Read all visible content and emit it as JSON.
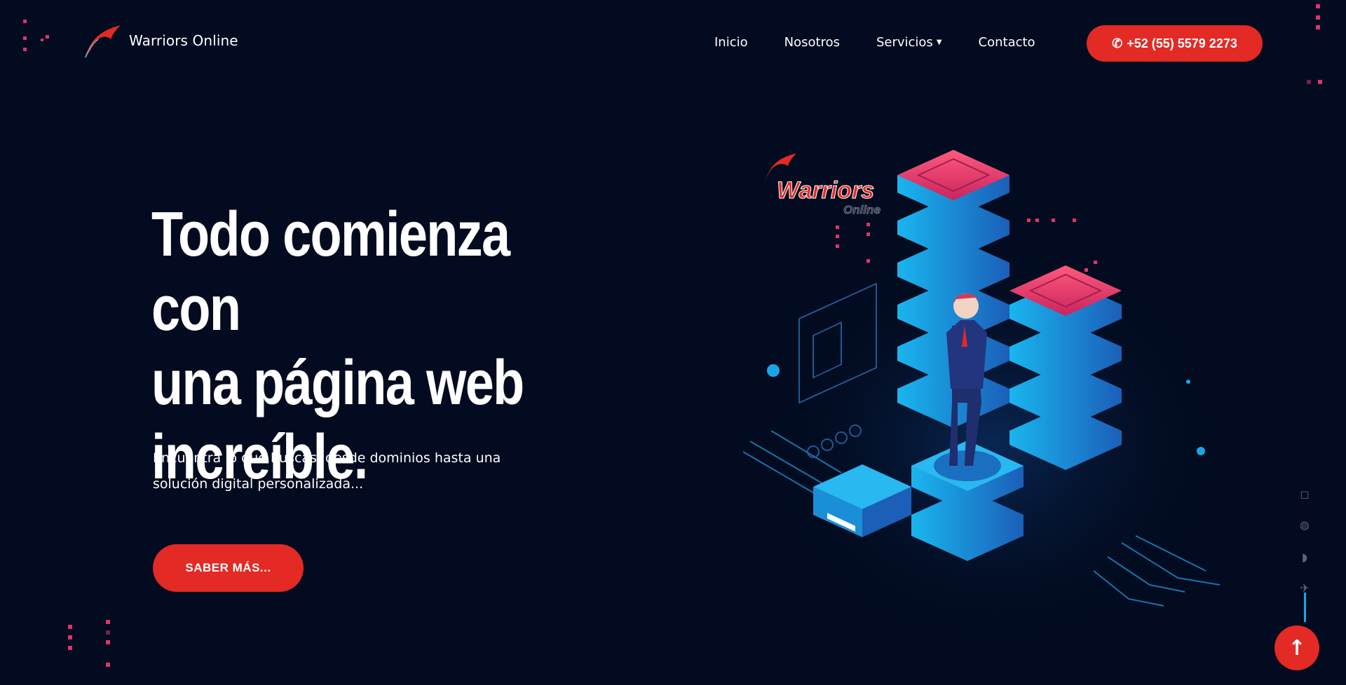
{
  "brand": {
    "name": "Warriors Online",
    "illustration_logo_text": [
      "Warriors",
      "Online"
    ]
  },
  "nav": {
    "items": [
      {
        "label": "Inicio",
        "has_dropdown": false
      },
      {
        "label": "Nosotros",
        "has_dropdown": false
      },
      {
        "label": "Servicios",
        "has_dropdown": true
      },
      {
        "label": "Contacto",
        "has_dropdown": false
      }
    ],
    "phone_label": "+52 (55) 5579 2273"
  },
  "hero": {
    "title_lines": [
      "Todo comienza con",
      "una página web",
      "increíble."
    ],
    "subtitle_lines": [
      "Encuentra lo que buscas, desde dominios hasta una",
      "solución digital personalizada..."
    ],
    "cta_label": "SABER MÁS..."
  },
  "social": {
    "icons": [
      "instagram-icon",
      "globe-icon",
      "spartan-helmet-icon",
      "airplane-icon"
    ]
  },
  "icons": {
    "phone": "phone-icon",
    "dropdown": "chevron-down-icon",
    "scroll_top": "arrow-up-icon"
  },
  "colors": {
    "background": "#020b1f",
    "accent": "#e32a25",
    "pink": "#e0336e",
    "server_blue": "#1aa6e6"
  }
}
